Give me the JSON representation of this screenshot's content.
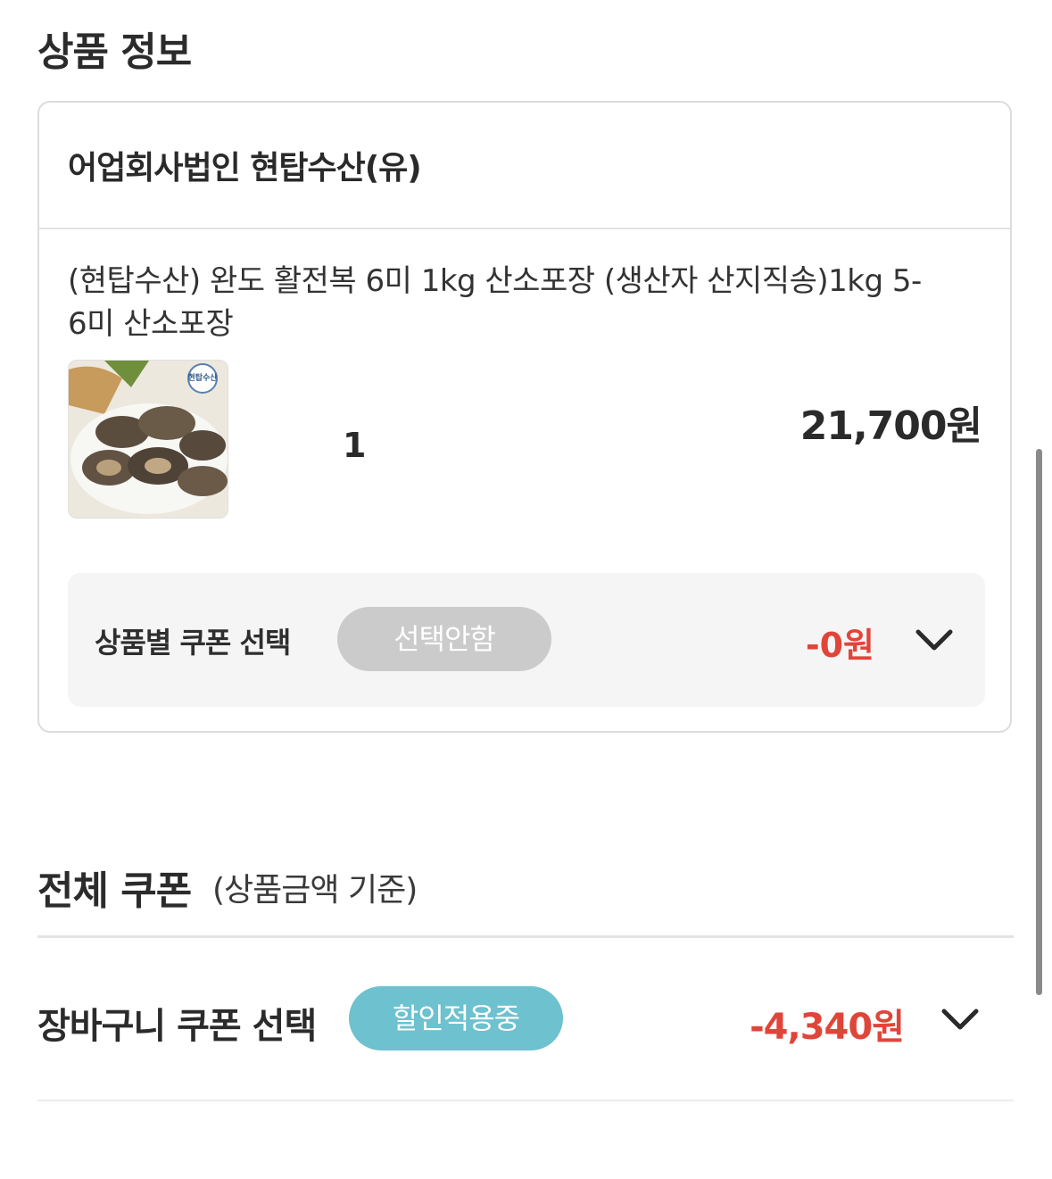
{
  "product_section": {
    "title": "상품 정보",
    "seller": "어업회사법인 현탑수산(유)",
    "product_name": "(현탑수산) 완도 활전복 6미 1kg 산소포장 (생산자 산지직송)1kg 5-6미 산소포장",
    "thumbnail_logo_text": "현탑수산",
    "quantity": "1",
    "price": "21,700원",
    "coupon": {
      "label": "상품별 쿠폰 선택",
      "selection": "선택안함",
      "discount": "-0원",
      "icon": "chevron-down-icon"
    }
  },
  "all_coupon_section": {
    "title": "전체 쿠폰",
    "subtitle": "(상품금액 기준)",
    "cart_coupon": {
      "label": "장바구니 쿠폰 선택",
      "status": "할인적용중",
      "discount": "-4,340원",
      "icon": "chevron-down-icon"
    }
  },
  "colors": {
    "discount": "#e0453a",
    "status_pill": "#6ec1cf",
    "inactive_pill": "#cbcbcb"
  }
}
